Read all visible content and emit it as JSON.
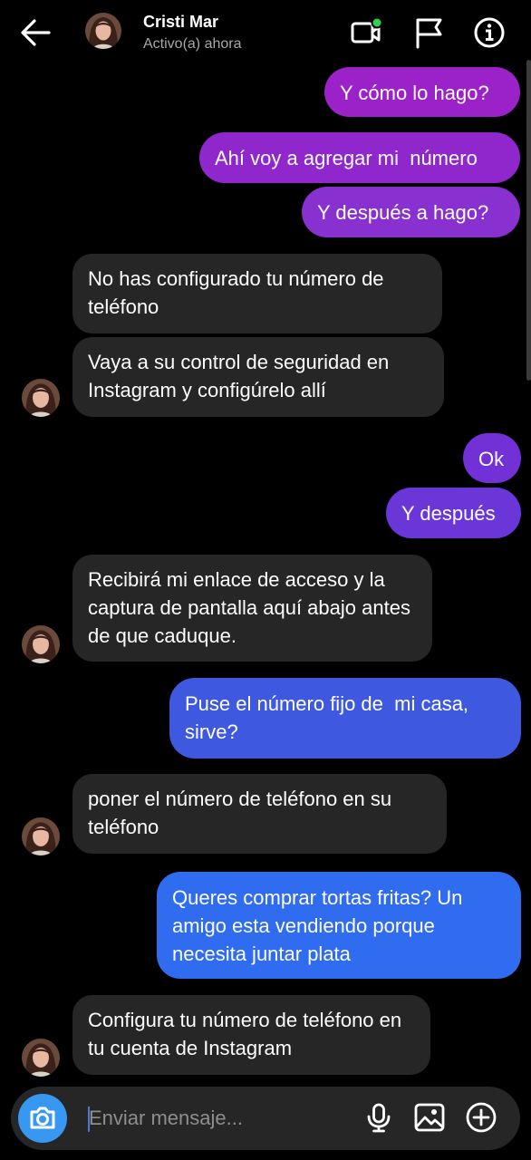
{
  "header": {
    "contact_name": "Cristi Mar",
    "status": "Activo(a) ahora",
    "icons": [
      "back-arrow-icon",
      "video-call-icon",
      "flag-icon",
      "info-icon"
    ]
  },
  "messages": [
    {
      "from": "me",
      "text": "Y cómo lo hago?"
    },
    {
      "from": "me",
      "text": "Ahí voy a agregar mi  número"
    },
    {
      "from": "me",
      "text": "Y después a hago?"
    },
    {
      "from": "them",
      "text": "No has configurado tu número de teléfono"
    },
    {
      "from": "them",
      "text": "Vaya a su control de seguridad en Instagram y configúrelo allí"
    },
    {
      "from": "me",
      "text": "Ok"
    },
    {
      "from": "me",
      "text": "Y después"
    },
    {
      "from": "them",
      "text": "Recibirá mi enlace de acceso y la captura de pantalla aquí abajo antes de que caduque."
    },
    {
      "from": "me",
      "text": "Puse el número fijo de  mi casa, sirve?"
    },
    {
      "from": "them",
      "text": "poner el número de teléfono en su teléfono"
    },
    {
      "from": "me",
      "text": "Queres comprar tortas fritas? Un amigo esta vendiendo porque necesita juntar plata"
    },
    {
      "from": "them",
      "text": "Configura tu número de teléfono en tu cuenta de Instagram"
    }
  ],
  "composer": {
    "placeholder": "Enviar mensaje...",
    "icons": [
      "camera-icon",
      "microphone-icon",
      "gallery-icon",
      "add-icon"
    ]
  },
  "colors": {
    "background": "#000000",
    "incoming_bubble": "#262626",
    "outgoing_purple": "#9b22c8",
    "outgoing_violet": "#6f34d8",
    "outgoing_blue": "#3e59e0",
    "outgoing_bright_blue": "#2f6cf0",
    "online_dot": "#2bd24b"
  }
}
